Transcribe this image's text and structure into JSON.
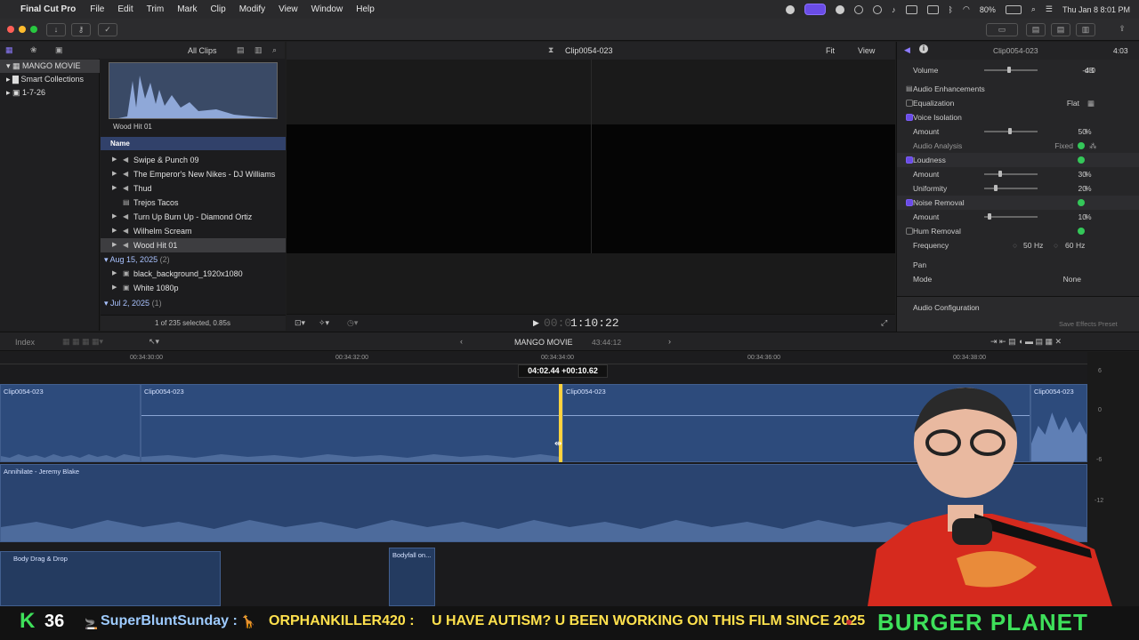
{
  "menubar": {
    "app": "Final Cut Pro",
    "items": [
      "File",
      "Edit",
      "Trim",
      "Mark",
      "Clip",
      "Modify",
      "View",
      "Window",
      "Help"
    ],
    "battery": "80%",
    "clock": "Thu Jan 8  8:01 PM"
  },
  "library": {
    "filter": "All Clips",
    "root": "MANGO MOVIE",
    "items": [
      "Smart Collections",
      "1-7-26"
    ]
  },
  "browser": {
    "thumb_label": "Wood Hit 01",
    "column": "Name",
    "rows": [
      "Swipe & Punch 09",
      "The Emperor's New Nikes - DJ Williams",
      "Thud",
      "Trejos Tacos",
      "Turn Up Burn Up - Diamond Ortiz",
      "Wilhelm Scream",
      "Wood Hit 01"
    ],
    "group1": {
      "date": "Aug 15, 2025",
      "count": "(2)"
    },
    "group1_rows": [
      "black_background_1920x1080",
      "White 1080p"
    ],
    "group2": {
      "date": "Jul 2, 2025",
      "count": "(1)"
    },
    "status": "1 of 235 selected, 0.85s"
  },
  "viewer": {
    "title": "Clip0054-023",
    "fit": "Fit",
    "view": "View",
    "timecode": "1:10:22",
    "timecode_dim": "00:0"
  },
  "inspector": {
    "title": "Clip0054-023",
    "duration": "4:03",
    "volume_label": "Volume",
    "volume": "-4.0",
    "volume_unit": "dB",
    "enh_header": "Audio Enhancements",
    "eq_label": "Equalization",
    "eq_value": "Flat",
    "vi_label": "Voice Isolation",
    "vi_amount_label": "Amount",
    "vi_amount": "50",
    "pct": "%",
    "analysis_label": "Audio Analysis",
    "analysis_value": "Fixed",
    "loud_label": "Loudness",
    "loud_amount_label": "Amount",
    "loud_amount": "30",
    "uni_label": "Uniformity",
    "uni_value": "20",
    "noise_label": "Noise Removal",
    "noise_amount_label": "Amount",
    "noise_amount": "10",
    "hum_label": "Hum Removal",
    "freq_label": "Frequency",
    "freq1": "50",
    "freq2": "60",
    "hz": "Hz",
    "pan_header": "Pan",
    "mode_label": "Mode",
    "mode_value": "None",
    "config": "Audio Configuration",
    "save": "Save Effects Preset"
  },
  "timeline": {
    "index": "Index",
    "project": "MANGO MOVIE",
    "duration": "43:44:12",
    "ticks": [
      "00:34:30:00",
      "00:34:32:00",
      "00:34:34:00",
      "00:34:36:00",
      "00:34:38:00"
    ],
    "trim_tooltip": "04:02.44  +00:10.62",
    "clips": [
      "Clip0054-023",
      "Clip0054-023",
      "Clip0054-023",
      "Clip0054-023"
    ],
    "music": "Annihilate - Jeremy Blake",
    "sfx1": "Body Drag & Drop",
    "sfx2": "Bodyfall on...",
    "meter_ticks": [
      "6",
      "0",
      "-6",
      "-12"
    ]
  },
  "ticker": {
    "k": "K",
    "count": "36",
    "user1": "SuperBluntSunday :",
    "user2": "ORPHANKILLER420 :",
    "msg": "U HAVE AUTISM? U BEEN WORKING ON THIS FILM SINCE 2025",
    "brand": "BURGER PLANET"
  },
  "colors": {
    "accent": "#6a4ce6",
    "clip": "#2d4b7c",
    "selection": "#ffd23f",
    "ticker_yellow": "#ffe14d",
    "ticker_green": "#3ee05a",
    "ticker_orange": "#ff8a3d"
  }
}
